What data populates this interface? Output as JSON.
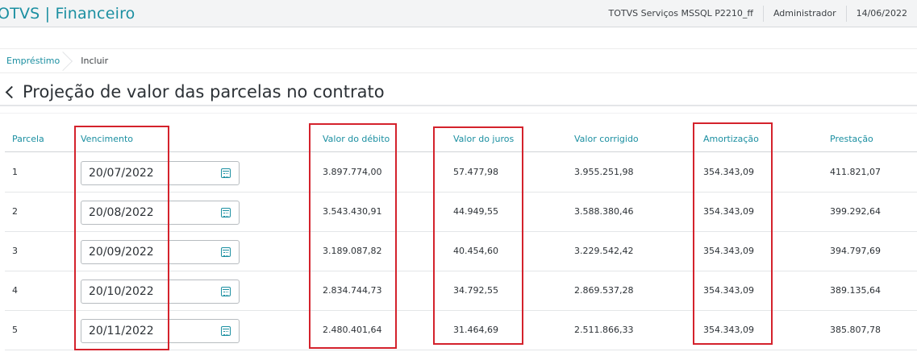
{
  "header": {
    "brand": "OTVS | Financeiro",
    "environment": "TOTVS Serviços MSSQL P2210_ff",
    "user": "Administrador",
    "date": "14/06/2022"
  },
  "breadcrumb": {
    "parent": "Empréstimo",
    "current": "Incluir"
  },
  "page": {
    "title": "Projeção de valor das parcelas no contrato"
  },
  "table": {
    "columns": {
      "parcela": "Parcela",
      "vencimento": "Vencimento",
      "valor_debito": "Valor do débito",
      "valor_juros": "Valor do juros",
      "valor_corrigido": "Valor corrigido",
      "amortizacao": "Amortização",
      "prestacao": "Prestação"
    },
    "rows": [
      {
        "parcela": "1",
        "vencimento": "20/07/2022",
        "valor_debito": "3.897.774,00",
        "valor_juros": "57.477,98",
        "valor_corrigido": "3.955.251,98",
        "amortizacao": "354.343,09",
        "prestacao": "411.821,07"
      },
      {
        "parcela": "2",
        "vencimento": "20/08/2022",
        "valor_debito": "3.543.430,91",
        "valor_juros": "44.949,55",
        "valor_corrigido": "3.588.380,46",
        "amortizacao": "354.343,09",
        "prestacao": "399.292,64"
      },
      {
        "parcela": "3",
        "vencimento": "20/09/2022",
        "valor_debito": "3.189.087,82",
        "valor_juros": "40.454,60",
        "valor_corrigido": "3.229.542,42",
        "amortizacao": "354.343,09",
        "prestacao": "394.797,69"
      },
      {
        "parcela": "4",
        "vencimento": "20/10/2022",
        "valor_debito": "2.834.744,73",
        "valor_juros": "34.792,55",
        "valor_corrigido": "2.869.537,28",
        "amortizacao": "354.343,09",
        "prestacao": "389.135,64"
      },
      {
        "parcela": "5",
        "vencimento": "20/11/2022",
        "valor_debito": "2.480.401,64",
        "valor_juros": "31.464,69",
        "valor_corrigido": "2.511.866,33",
        "amortizacao": "354.343,09",
        "prestacao": "385.807,78"
      }
    ]
  },
  "colors": {
    "accent": "#1b8fa1",
    "highlight": "#d4222c"
  },
  "icons": {
    "back": "chevron-left-icon",
    "date_picker": "calendar-icon"
  }
}
